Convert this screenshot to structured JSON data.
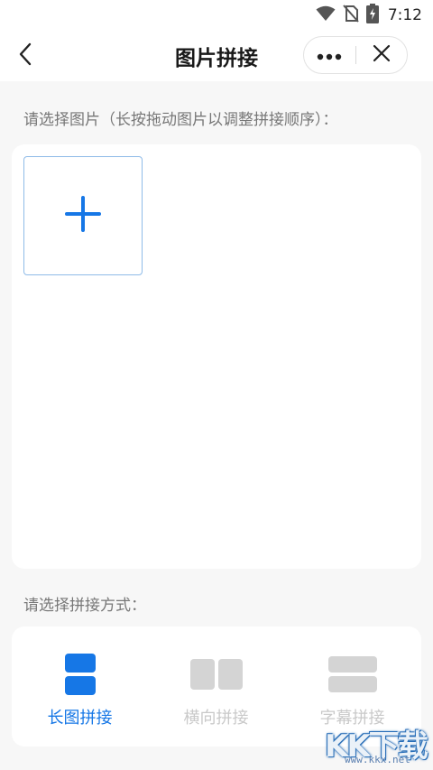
{
  "status_bar": {
    "time": "7:12",
    "icons": [
      "wifi-icon",
      "no-sim-icon",
      "battery-charging-icon"
    ]
  },
  "nav": {
    "title": "图片拼接",
    "back_icon": "chevron-left-icon",
    "more_icon": "more-dots-icon",
    "close_icon": "close-icon"
  },
  "images_section": {
    "label": "请选择图片（长按拖动图片以调整拼接顺序）：",
    "add_icon": "plus-icon"
  },
  "mode_section": {
    "label": "请选择拼接方式：",
    "modes": [
      {
        "label": "长图拼接",
        "icon": "vertical-stitch-icon",
        "selected": true
      },
      {
        "label": "横向拼接",
        "icon": "horizontal-stitch-icon",
        "selected": false
      },
      {
        "label": "字幕拼接",
        "icon": "subtitle-stitch-icon",
        "selected": false
      }
    ]
  },
  "watermark": {
    "brand": "KK下载",
    "url": "www.kkx.net"
  },
  "colors": {
    "accent": "#1677e6",
    "inactive": "#d4d4d4",
    "background": "#f7f7f7"
  }
}
